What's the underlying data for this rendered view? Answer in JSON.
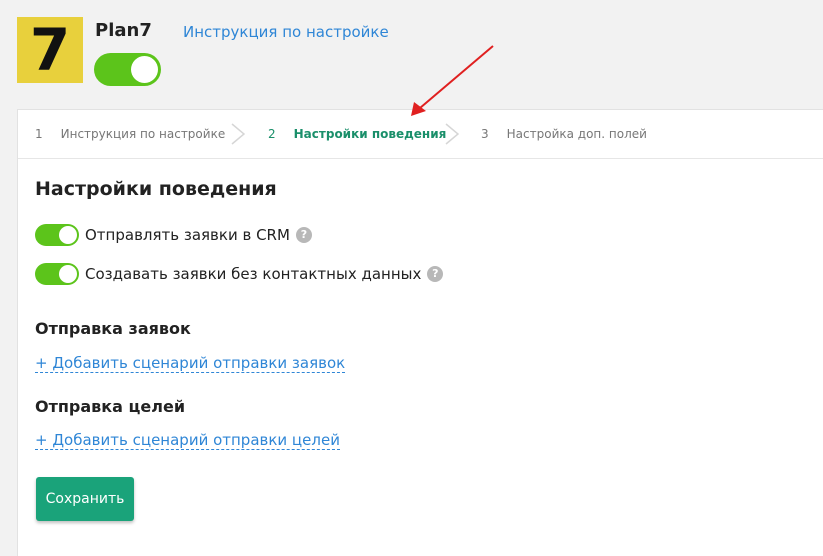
{
  "header": {
    "logo_glyph": "7",
    "app_name": "Plan7",
    "setup_link": "Инструкция по настройке",
    "enabled": true
  },
  "steps": [
    {
      "num": "1",
      "label": "Инструкция по настройке",
      "active": false
    },
    {
      "num": "2",
      "label": "Настройки поведения",
      "active": true
    },
    {
      "num": "3",
      "label": "Настройка доп. полей",
      "active": false
    }
  ],
  "main": {
    "title": "Настройки поведения",
    "options": [
      {
        "label": "Отправлять заявки в CRM",
        "enabled": true,
        "help_glyph": "?"
      },
      {
        "label": "Создавать заявки без контактных данных",
        "enabled": true,
        "help_glyph": "?"
      }
    ],
    "leads_section": {
      "title": "Отправка заявок",
      "add_link": "+ Добавить сценарий отправки заявок"
    },
    "goals_section": {
      "title": "Отправка целей",
      "add_link": "+ Добавить сценарий отправки целей"
    },
    "save_label": "Сохранить"
  },
  "colors": {
    "toggle_on": "#5cc41b",
    "link": "#2f86d6",
    "active_step": "#1a8f6a",
    "save_button": "#1aa37a",
    "logo_bg": "#e8d03c",
    "annotation_arrow": "#e02020"
  }
}
